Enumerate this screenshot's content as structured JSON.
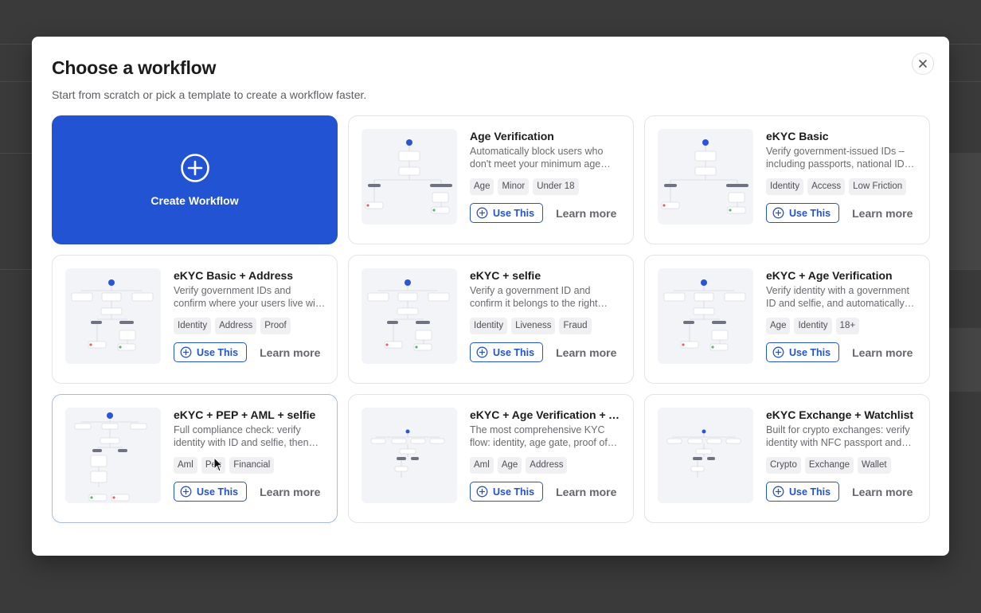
{
  "modal": {
    "title": "Choose a workflow",
    "subtitle": "Start from scratch or pick a template to create a workflow faster.",
    "close_icon": "close-icon"
  },
  "create": {
    "label": "Create Workflow",
    "icon": "plus-circle-icon"
  },
  "colors": {
    "accent": "#2253d3",
    "backdrop": "#3a3a3a"
  },
  "templates": [
    {
      "title": "Age Verification",
      "description": "Automatically block users who don't meet your minimum age requirement",
      "tags": [
        "Age",
        "Minor",
        "Under 18"
      ],
      "use_label": "Use This",
      "learn_label": "Learn more"
    },
    {
      "title": "eKYC Basic",
      "description": "Verify government-issued IDs – including passports, national IDs and more",
      "tags": [
        "Identity",
        "Access",
        "Low Friction"
      ],
      "use_label": "Use This",
      "learn_label": "Learn more"
    },
    {
      "title": "eKYC Basic + Address",
      "description": "Verify government IDs and confirm where your users live with proof of address",
      "tags": [
        "Identity",
        "Address",
        "Proof"
      ],
      "use_label": "Use This",
      "learn_label": "Learn more"
    },
    {
      "title": "eKYC + selfie",
      "description": "Verify a government ID and confirm it belongs to the right person with a selfie",
      "tags": [
        "Identity",
        "Liveness",
        "Fraud"
      ],
      "use_label": "Use This",
      "learn_label": "Learn more"
    },
    {
      "title": "eKYC + Age Verification",
      "description": "Verify identity with a government ID and selfie, and automatically block minors",
      "tags": [
        "Age",
        "Identity",
        "18+"
      ],
      "use_label": "Use This",
      "learn_label": "Learn more"
    },
    {
      "title": "eKYC + PEP + AML + selfie",
      "description": "Full compliance check: verify identity with ID and selfie, then screen for PEP and AML",
      "tags": [
        "Aml",
        "Pep",
        "Financial"
      ],
      "use_label": "Use This",
      "learn_label": "Learn more"
    },
    {
      "title": "eKYC + Age Verification + Address",
      "description": "The most comprehensive KYC flow: identity, age gate, proof of address",
      "tags": [
        "Aml",
        "Age",
        "Address"
      ],
      "use_label": "Use This",
      "learn_label": "Learn more"
    },
    {
      "title": "eKYC Exchange + Watchlist",
      "description": "Built for crypto exchanges: verify identity with NFC passport and watchlist screening",
      "tags": [
        "Crypto",
        "Exchange",
        "Wallet"
      ],
      "use_label": "Use This",
      "learn_label": "Learn more"
    }
  ]
}
